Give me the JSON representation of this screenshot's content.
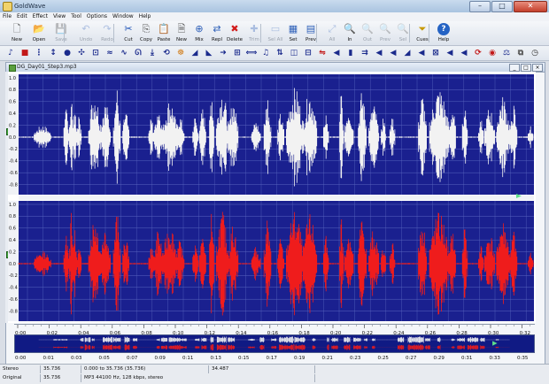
{
  "window": {
    "title": "GoldWave",
    "minimize": "–",
    "maximize": "□",
    "close": "✕"
  },
  "menu": [
    "File",
    "Edit",
    "Effect",
    "View",
    "Tool",
    "Options",
    "Window",
    "Help"
  ],
  "toolbar": [
    {
      "label": "New",
      "icon": "new-file-icon",
      "glyph": "🗋",
      "enabled": true
    },
    {
      "label": "Open",
      "icon": "open-folder-icon",
      "glyph": "📂",
      "enabled": true
    },
    {
      "label": "Save",
      "icon": "save-icon",
      "glyph": "💾",
      "enabled": false
    },
    {
      "label": "Undo",
      "icon": "undo-icon",
      "glyph": "↶",
      "enabled": false
    },
    {
      "label": "Redo",
      "icon": "redo-icon",
      "glyph": "↷",
      "enabled": false
    },
    {
      "label": "Cut",
      "icon": "cut-icon",
      "glyph": "✂",
      "enabled": true
    },
    {
      "label": "Copy",
      "icon": "copy-icon",
      "glyph": "⎘",
      "enabled": true
    },
    {
      "label": "Paste",
      "icon": "paste-icon",
      "glyph": "📋",
      "enabled": true
    },
    {
      "label": "New",
      "icon": "paste-new-icon",
      "glyph": "🗎",
      "enabled": true
    },
    {
      "label": "Mix",
      "icon": "mix-icon",
      "glyph": "⊕",
      "enabled": true
    },
    {
      "label": "Repl",
      "icon": "replace-icon",
      "glyph": "⇄",
      "enabled": true
    },
    {
      "label": "Delete",
      "icon": "delete-icon",
      "glyph": "✖",
      "enabled": true
    },
    {
      "label": "Trim",
      "icon": "trim-icon",
      "glyph": "✚",
      "enabled": false
    },
    {
      "label": "Sel All",
      "icon": "select-all-icon",
      "glyph": "▭",
      "enabled": false
    },
    {
      "label": "Set",
      "icon": "set-icon",
      "glyph": "▦",
      "enabled": true
    },
    {
      "label": "Prev",
      "icon": "preview-icon",
      "glyph": "▤",
      "enabled": true
    },
    {
      "label": "All",
      "icon": "zoom-all-icon",
      "glyph": "⤢",
      "enabled": false
    },
    {
      "label": "In",
      "icon": "zoom-in-icon",
      "glyph": "🔍",
      "enabled": true
    },
    {
      "label": "Out",
      "icon": "zoom-out-icon",
      "glyph": "🔍",
      "enabled": false
    },
    {
      "label": "Prev",
      "icon": "zoom-previous-icon",
      "glyph": "🔍",
      "enabled": false
    },
    {
      "label": "Sel",
      "icon": "zoom-selection-icon",
      "glyph": "🔍",
      "enabled": false
    },
    {
      "label": "Cues",
      "icon": "cues-icon",
      "glyph": "⏷",
      "enabled": true
    },
    {
      "label": "Help",
      "icon": "help-icon",
      "glyph": "?",
      "enabled": true
    }
  ],
  "effects_toolbar": [
    {
      "icon": "audio-effect-icon",
      "glyph": "♪"
    },
    {
      "icon": "record-monitor-icon",
      "glyph": "■"
    },
    {
      "icon": "spectrum-icon",
      "glyph": "⋮"
    },
    {
      "icon": "expander-icon",
      "glyph": "↕"
    },
    {
      "icon": "globe-icon",
      "glyph": "●"
    },
    {
      "icon": "equalizer-icon",
      "glyph": "✣"
    },
    {
      "icon": "mechanize-icon",
      "glyph": "⊡"
    },
    {
      "icon": "echo-icon",
      "glyph": "≈"
    },
    {
      "icon": "offset-icon",
      "glyph": "∿"
    },
    {
      "icon": "flanger-icon",
      "glyph": "ᘏ"
    },
    {
      "icon": "mix-down-icon",
      "glyph": "⤓"
    },
    {
      "icon": "reverse-icon",
      "glyph": "⟲"
    },
    {
      "icon": "noise-reduction-icon",
      "glyph": "☸"
    },
    {
      "icon": "fade-in-icon",
      "glyph": "◢"
    },
    {
      "icon": "fade-out-icon",
      "glyph": "◣"
    },
    {
      "icon": "shape-icon",
      "glyph": "➜"
    },
    {
      "icon": "channel-mixer-icon",
      "glyph": "⊞"
    },
    {
      "icon": "matcher-icon",
      "glyph": "⟺"
    },
    {
      "icon": "pitch-icon",
      "glyph": "♫"
    },
    {
      "icon": "resample-icon",
      "glyph": "⇅"
    },
    {
      "icon": "stereo-icon",
      "glyph": "◫"
    },
    {
      "icon": "silence-icon",
      "glyph": "⊟"
    },
    {
      "icon": "pan-icon",
      "glyph": "⇋"
    },
    {
      "icon": "volume-icon",
      "glyph": "◀"
    },
    {
      "icon": "compressor-icon",
      "glyph": "▮"
    },
    {
      "icon": "doppler-icon",
      "glyph": "⇉"
    },
    {
      "icon": "auto-gain-icon",
      "glyph": "◀"
    },
    {
      "icon": "maximize-volume-icon",
      "glyph": "◀"
    },
    {
      "icon": "volume-shape-icon",
      "glyph": "◢"
    },
    {
      "icon": "volume-match-icon",
      "glyph": "◀"
    },
    {
      "icon": "filter-icon",
      "glyph": "⊠"
    },
    {
      "icon": "lowpass-icon",
      "glyph": "◀"
    },
    {
      "icon": "bandpass-icon",
      "glyph": "◀"
    },
    {
      "icon": "declick-icon",
      "glyph": "⟳"
    },
    {
      "icon": "cdrom-icon",
      "glyph": "◉"
    },
    {
      "icon": "spatial-icon",
      "glyph": "⚖"
    },
    {
      "icon": "interpolate-icon",
      "glyph": "⧉"
    },
    {
      "icon": "time-warp-icon",
      "glyph": "◷"
    }
  ],
  "document": {
    "filename": "DG_Day01_Step3.mp3",
    "minimize": "_",
    "maximize": "□",
    "close": "×"
  },
  "waveform": {
    "background": "#1a208f",
    "left_color": "#f2f2f2",
    "right_color": "#ef1c1c",
    "grid_color": "#5a66c0",
    "amplitude_ticks": [
      "1.0",
      "0.8",
      "0.6",
      "0.4",
      "0.2",
      "0.0",
      "-0.2",
      "-0.4",
      "-0.6",
      "-0.8"
    ]
  },
  "timeline": {
    "labels": [
      "0:00",
      "0:02",
      "0:04",
      "0:06",
      "0:08",
      "0:10",
      "0:12",
      "0:14",
      "0:16",
      "0:18",
      "0:20",
      "0:22",
      "0:24",
      "0:26",
      "0:28",
      "0:30",
      "0:32",
      "0:34"
    ],
    "overview_labels": [
      "0:00",
      "0:01",
      "0:03",
      "0:05",
      "0:07",
      "0:09",
      "0:11",
      "0:13",
      "0:15",
      "0:17",
      "0:19",
      "0:21",
      "0:23",
      "0:25",
      "0:27",
      "0:29",
      "0:31",
      "0:33",
      "0:35"
    ]
  },
  "status": {
    "row1": [
      "Stereo",
      "35.736",
      "0.000 to 35.736 (35.736)",
      "34.487"
    ],
    "row2": [
      "Original",
      "35.736",
      "MP3 44100 Hz, 128 kbps, stereo"
    ]
  }
}
